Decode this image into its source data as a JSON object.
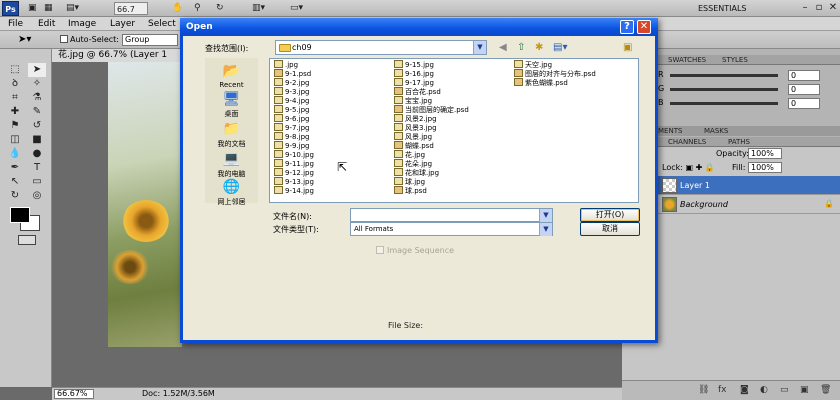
{
  "app": {
    "logo": "Ps",
    "zoom": "66.7",
    "workspace": "ESSENTIALS",
    "menus": [
      "File",
      "Edit",
      "Image",
      "Layer",
      "Select"
    ],
    "options": {
      "auto_select": "Auto-Select:",
      "group": "Group"
    },
    "doc_tab": "花.jpg @ 66.7% (Layer 1",
    "status": {
      "zoom": "66.67%",
      "doc": "Doc: 1.52M/3.56M"
    }
  },
  "panels": {
    "top_tabs": [
      "SWATCHES",
      "STYLES"
    ],
    "color": {
      "r": "0",
      "g": "0",
      "b": "0",
      "labels": [
        "R",
        "G",
        "B"
      ]
    },
    "mid_tabs": [
      "MENTS",
      "MASKS"
    ],
    "layer_tabs": [
      "CHANNELS",
      "PATHS"
    ],
    "opacity_label": "Opacity:",
    "opacity": "100%",
    "fill_label": "Fill:",
    "fill": "100%",
    "lock_label": "Lock:",
    "layers": [
      {
        "name": "Layer 1",
        "selected": true
      },
      {
        "name": "Background",
        "selected": false
      }
    ]
  },
  "dialog": {
    "title": "Open",
    "help": "?",
    "close": "✕",
    "look_in_label": "查找范围(I):",
    "look_in": "ch09",
    "places": [
      "Recent",
      "桌面",
      "我的文档",
      "我的电脑",
      "网上邻居"
    ],
    "files": {
      "col1": [
        {
          "name": ".jpg",
          "t": "jpg"
        },
        {
          "name": "9-1.psd",
          "t": "psd"
        },
        {
          "name": "9-2.jpg",
          "t": "jpg"
        },
        {
          "name": "9-3.jpg",
          "t": "jpg"
        },
        {
          "name": "9-4.jpg",
          "t": "jpg"
        },
        {
          "name": "9-5.jpg",
          "t": "jpg"
        },
        {
          "name": "9-6.jpg",
          "t": "jpg"
        },
        {
          "name": "9-7.jpg",
          "t": "jpg"
        },
        {
          "name": "9-8.jpg",
          "t": "jpg"
        },
        {
          "name": "9-9.jpg",
          "t": "jpg"
        },
        {
          "name": "9-10.jpg",
          "t": "jpg"
        },
        {
          "name": "9-11.jpg",
          "t": "jpg"
        },
        {
          "name": "9-12.jpg",
          "t": "jpg"
        },
        {
          "name": "9-13.jpg",
          "t": "jpg"
        },
        {
          "name": "9-14.jpg",
          "t": "jpg"
        }
      ],
      "col2": [
        {
          "name": "9-15.jpg",
          "t": "jpg"
        },
        {
          "name": "9-16.jpg",
          "t": "jpg"
        },
        {
          "name": "9-17.jpg",
          "t": "jpg"
        },
        {
          "name": "百合花.psd",
          "t": "psd"
        },
        {
          "name": "宝宝.jpg",
          "t": "jpg"
        },
        {
          "name": "当前图层的确定.psd",
          "t": "psd"
        },
        {
          "name": "风景2.jpg",
          "t": "jpg"
        },
        {
          "name": "风景3.jpg",
          "t": "jpg"
        },
        {
          "name": "风景.jpg",
          "t": "jpg"
        },
        {
          "name": "蝴蝶.psd",
          "t": "psd"
        },
        {
          "name": "花.jpg",
          "t": "jpg"
        },
        {
          "name": "花朵.jpg",
          "t": "jpg"
        },
        {
          "name": "花和球.jpg",
          "t": "jpg"
        },
        {
          "name": "球.jpg",
          "t": "jpg"
        },
        {
          "name": "球.psd",
          "t": "psd"
        }
      ],
      "col3": [
        {
          "name": "天空.jpg",
          "t": "jpg"
        },
        {
          "name": "图层的对齐与分布.psd",
          "t": "psd"
        },
        {
          "name": "紫色蝴蝶.psd",
          "t": "psd"
        }
      ]
    },
    "filename_label": "文件名(N):",
    "filename_value": "",
    "filetype_label": "文件类型(T):",
    "filetype_value": "All Formats",
    "open_button": "打开(O)",
    "cancel_button": "取消",
    "image_sequence": "Image Sequence",
    "file_size_label": "File Size:"
  }
}
